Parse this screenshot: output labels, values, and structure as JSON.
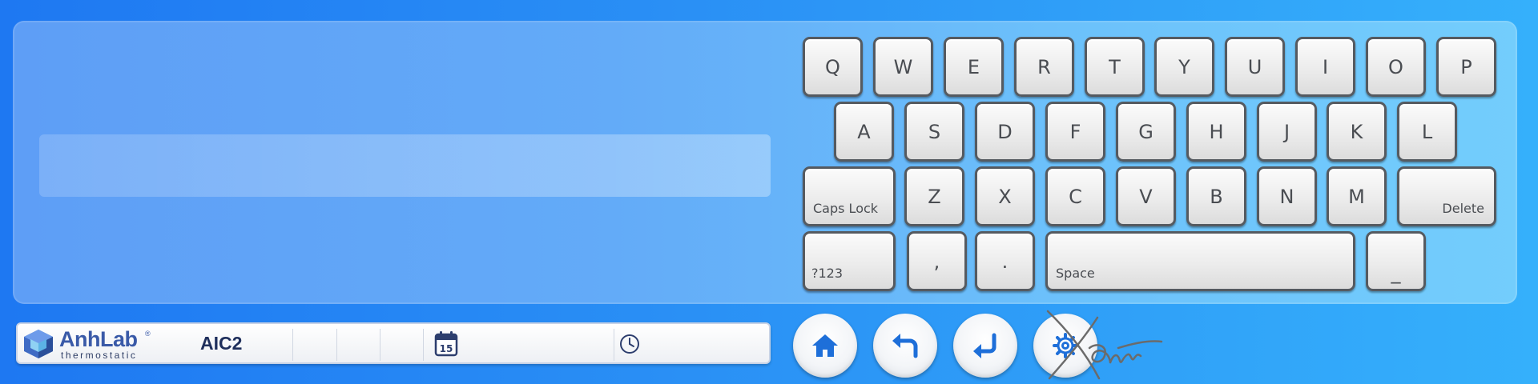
{
  "input": {
    "value": "",
    "placeholder": ""
  },
  "keyboard": {
    "row1": [
      "Q",
      "W",
      "E",
      "R",
      "T",
      "Y",
      "U",
      "I",
      "O",
      "P"
    ],
    "row2": [
      "A",
      "S",
      "D",
      "F",
      "G",
      "H",
      "J",
      "K",
      "L"
    ],
    "row3": [
      "Z",
      "X",
      "C",
      "V",
      "B",
      "N",
      "M"
    ],
    "caps_lock": "Caps Lock",
    "delete": "Delete",
    "numbers": "?123",
    "comma": ",",
    "period": ".",
    "space": "Space",
    "underscore": "_"
  },
  "status_bar": {
    "logo_name": "AnhLab",
    "logo_registered": "®",
    "logo_sub": "thermostatic",
    "device_name": "AIC2",
    "calendar_day": "15",
    "icons": [
      "calendar-icon",
      "clock-icon"
    ]
  },
  "nav_buttons": [
    "home-icon",
    "back-icon",
    "enter-icon",
    "settings-icon"
  ],
  "colors": {
    "key_border": "#555a60",
    "icon_blue": "#1e6fd9",
    "brand": "#3a5aa8"
  }
}
